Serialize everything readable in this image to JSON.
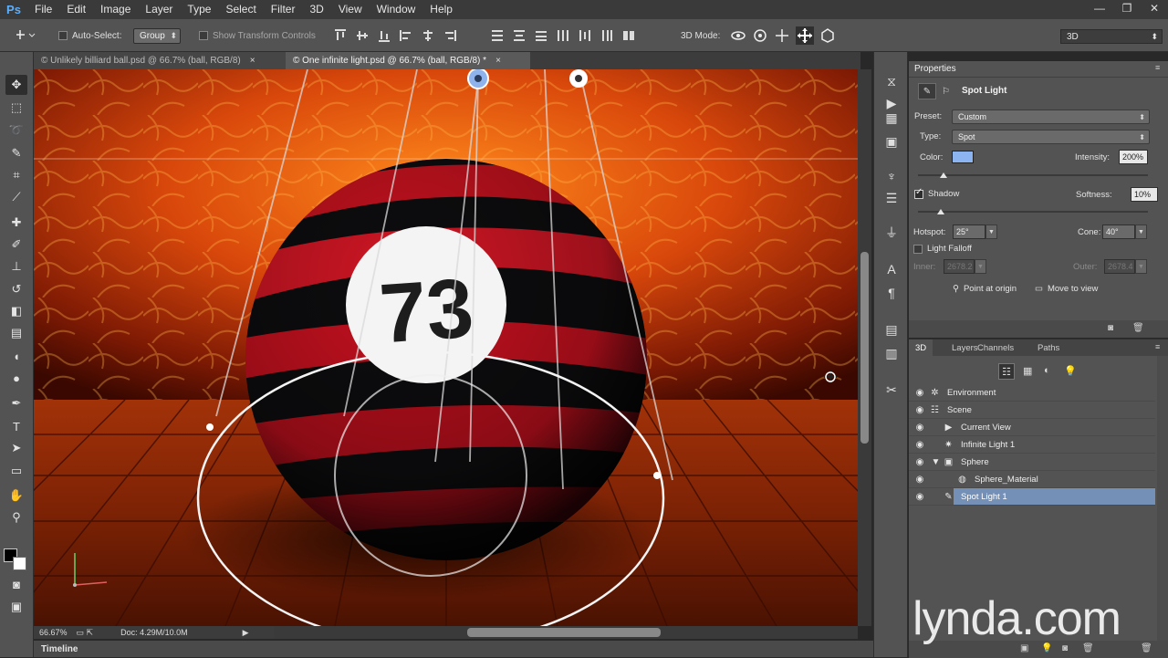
{
  "app": {
    "logo": "Ps"
  },
  "menu": [
    "File",
    "Edit",
    "Image",
    "Layer",
    "Type",
    "Select",
    "Filter",
    "3D",
    "View",
    "Window",
    "Help"
  ],
  "window_controls": [
    "—",
    "❐",
    "✕"
  ],
  "options": {
    "auto_select_label": "Auto-Select:",
    "auto_select_value": "Group",
    "show_transform_label": "Show Transform Controls",
    "mode_label": "3D Mode:"
  },
  "workspace": "3D",
  "tabs": [
    {
      "label": "© Unlikely billiard ball.psd @ 66.7% (ball, RGB/8)",
      "close": "×"
    },
    {
      "label": "© One infinite light.psd @ 66.7% (ball, RGB/8) *",
      "close": "×"
    }
  ],
  "canvas": {
    "ball_number": "73"
  },
  "status": {
    "zoom": "66.67%",
    "doc": "Doc: 4.29M/10.0M"
  },
  "timeline_label": "Timeline",
  "properties": {
    "tab": "Properties",
    "title": "Spot Light",
    "preset_label": "Preset:",
    "preset_value": "Custom",
    "type_label": "Type:",
    "type_value": "Spot",
    "color_label": "Color:",
    "color_value": "#8cb4f0",
    "intensity_label": "Intensity:",
    "intensity_value": "200%",
    "intensity_slider": 0.11,
    "shadow_label": "Shadow",
    "softness_label": "Softness:",
    "softness_value": "10%",
    "softness_slider": 0.1,
    "hotspot_label": "Hotspot:",
    "hotspot_value": "25°",
    "cone_label": "Cone:",
    "cone_value": "40°",
    "falloff_label": "Light Falloff",
    "inner_label": "Inner:",
    "inner_value": "2678.2",
    "outer_label": "Outer:",
    "outer_value": "2678.4",
    "point_origin_label": "Point at origin",
    "move_view_label": "Move to view"
  },
  "layers_panel": {
    "tabs": [
      "3D",
      "Layers",
      "Channels",
      "Paths"
    ],
    "rows": [
      {
        "name": "Environment"
      },
      {
        "name": "Scene"
      },
      {
        "name": "Current View"
      },
      {
        "name": "Infinite Light 1"
      },
      {
        "name": "Sphere"
      },
      {
        "name": "Sphere_Material"
      },
      {
        "name": "Spot Light 1"
      }
    ]
  },
  "watermark": "lynda.com"
}
